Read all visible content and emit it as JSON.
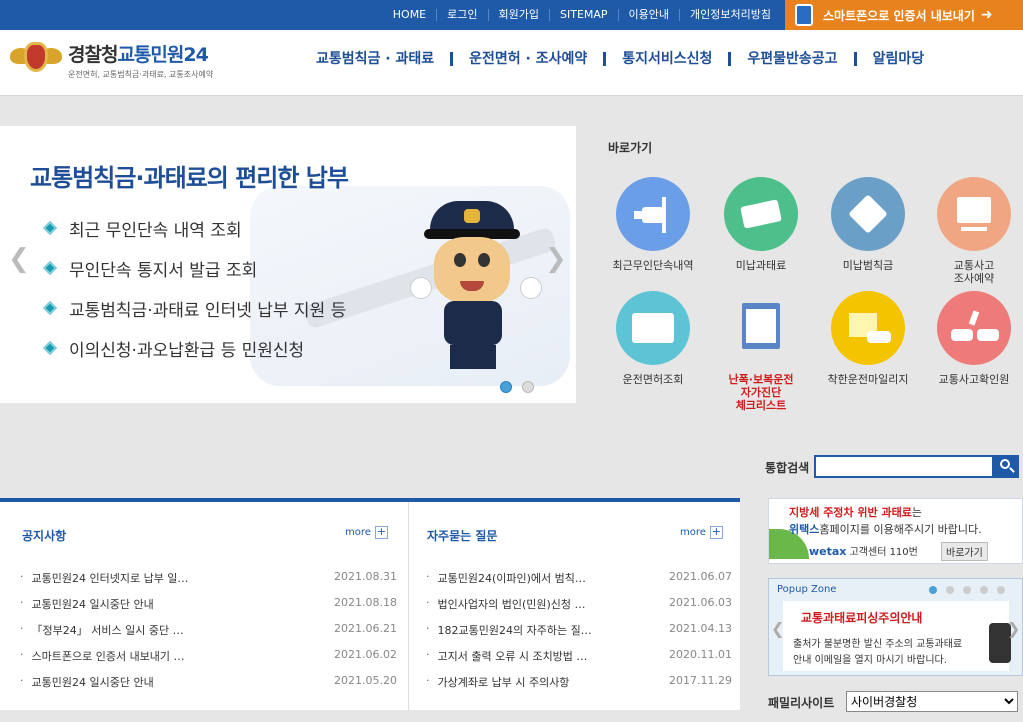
{
  "topbar": {
    "links": [
      "HOME",
      "로그인",
      "회원가입",
      "SITEMAP",
      "이용안내",
      "개인정보처리방침"
    ],
    "smartphone_label": "스마트폰으로 인증서 내보내기"
  },
  "header": {
    "logo_title_1": "경찰청",
    "logo_title_2": "교통민원24",
    "logo_sub": "운전면허, 교통범칙금·과태료, 교통조사예약",
    "gnb": [
      "교통범칙금 · 과태료",
      "운전면허 · 조사예약",
      "통지서비스신청",
      "우편물반송공고",
      "알림마당"
    ]
  },
  "slider": {
    "title": "교통범칙금·과태료의 편리한 납부",
    "items": [
      "최근 무인단속 내역 조회",
      "무인단속 통지서 발급 조회",
      "교통범칙금·과태료 인터넷 납부 지원 등",
      "이의신청·과오납환급 등 민원신청"
    ],
    "active_slide": 1,
    "slide_count": 2
  },
  "quick": {
    "title": "바로가기",
    "items": [
      {
        "label": "최근무인단속내역",
        "color": "#6b9ee8",
        "icon": "camera-icon"
      },
      {
        "label": "미납과태료",
        "color": "#4cbf8a",
        "icon": "money-icon"
      },
      {
        "label": "미납범칙금",
        "color": "#6aa0c8",
        "icon": "warning-icon"
      },
      {
        "label": "교통사고\n조사예약",
        "color": "#f0a682",
        "icon": "computer-icon"
      },
      {
        "label": "운전면허조회",
        "color": "#5dc4d6",
        "icon": "license-card-icon"
      },
      {
        "label": "난폭·보복운전\n자가진단\n체크리스트",
        "color": "#e6e6e6",
        "icon": "checklist-icon",
        "highlight": true
      },
      {
        "label": "착한운전마일리지",
        "color": "#f5c400",
        "icon": "mileage-car-icon"
      },
      {
        "label": "교통사고확인원",
        "color": "#ee7a7a",
        "icon": "car-crash-icon"
      }
    ]
  },
  "search": {
    "label": "통합검색",
    "value": ""
  },
  "notices": {
    "title": "공지사항",
    "more": "more",
    "rows": [
      {
        "title": "교통민원24 인터넷지로 납부 일…",
        "date": "2021.08.31"
      },
      {
        "title": "교통민원24 일시중단 안내",
        "date": "2021.08.18"
      },
      {
        "title": "「정부24」 서비스 일시 중단 …",
        "date": "2021.06.21"
      },
      {
        "title": "스마트폰으로 인증서 내보내기 …",
        "date": "2021.06.02"
      },
      {
        "title": "교통민원24 일시중단 안내",
        "date": "2021.05.20"
      }
    ]
  },
  "faq": {
    "title": "자주묻는 질문",
    "more": "more",
    "rows": [
      {
        "title": "교통민원24(이파인)에서 범칙…",
        "date": "2021.06.07"
      },
      {
        "title": "법인사업자의 법인(민원)신청 …",
        "date": "2021.06.03"
      },
      {
        "title": "182교통민원24의 자주하는 질…",
        "date": "2021.04.13"
      },
      {
        "title": "고지서 출력 오류 시 조치방법 …",
        "date": "2020.11.01"
      },
      {
        "title": "가상계좌로 납부 시 주의사항",
        "date": "2017.11.29"
      }
    ]
  },
  "banner": {
    "line1_red": "지방세 주정차 위반 과태료",
    "line1_rest": "는",
    "line2_bold": "위택스",
    "line2_rest": "홈페이지를 이용해주시기 바랍니다.",
    "wetax": "wetax",
    "callcenter": "고객센터 110번",
    "go": "바로가기"
  },
  "popup": {
    "title": "Popup Zone",
    "heading": "교통과태료피싱주의안내",
    "body1": "출처가 불분명한 발신 주소의 교통과태료",
    "body2": "안내 이메일을 열지 마시기 바랍니다.",
    "active_dot": 1,
    "dot_count": 5
  },
  "family": {
    "label": "패밀리사이트",
    "selected": "사이버경찰청"
  }
}
